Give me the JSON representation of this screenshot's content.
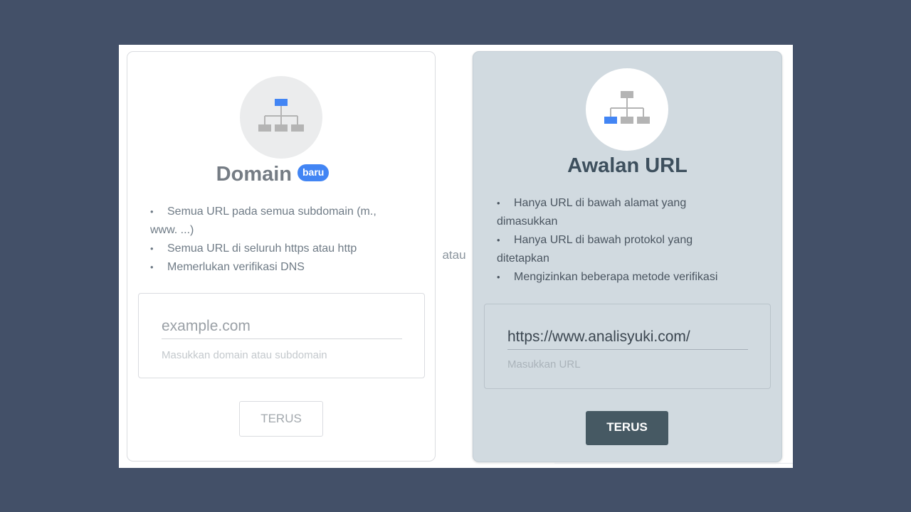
{
  "separator": "atau",
  "domain_card": {
    "icon": "sitemap-icon",
    "title": "Domain",
    "badge": "baru",
    "features": [
      "Semua URL pada semua subdomain (m., www. ...)",
      "Semua URL di seluruh https atau http",
      "Memerlukan verifikasi DNS"
    ],
    "input_value": "",
    "input_placeholder": "example.com",
    "helper": "Masukkan domain atau subdomain",
    "button": "TERUS"
  },
  "url_card": {
    "icon": "sitemap-icon",
    "title": "Awalan URL",
    "features": [
      "Hanya URL di bawah alamat yang dimasukkan",
      "Hanya URL di bawah protokol yang ditetapkan",
      "Mengizinkan beberapa metode verifikasi"
    ],
    "input_value": "https://www.analisyuki.com/",
    "helper": "Masukkan URL",
    "button": "TERUS"
  },
  "colors": {
    "background": "#435068",
    "accent_blue": "#4285f4",
    "button_dark": "#465963",
    "icon_gray": "#b4b4b4"
  }
}
